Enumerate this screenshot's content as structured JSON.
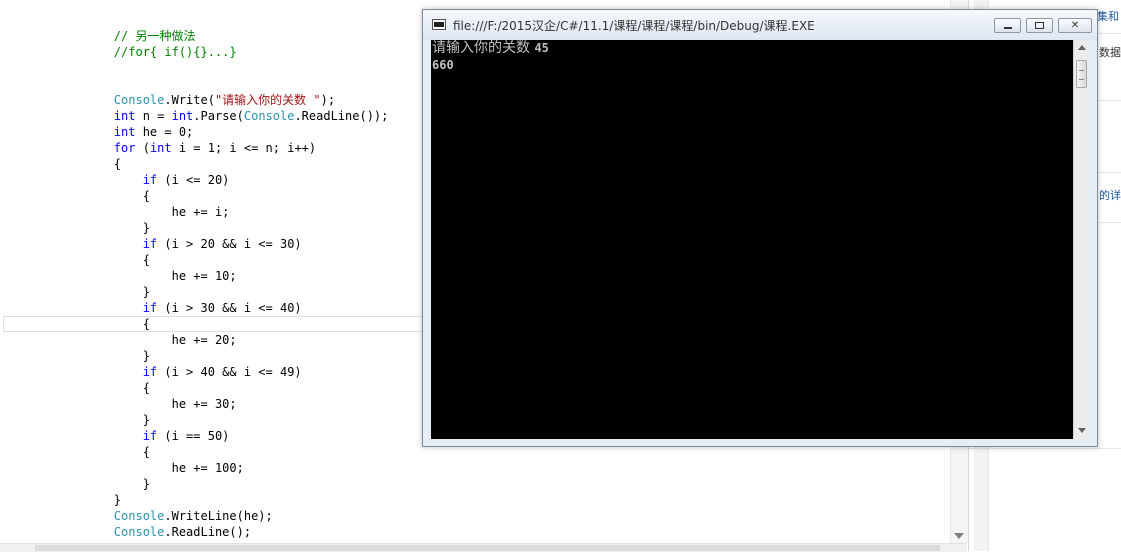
{
  "editor": {
    "lines": [
      {
        "indent": "        ",
        "segments": [
          {
            "t": "// 另一种做法",
            "c": "cm"
          }
        ]
      },
      {
        "indent": "        ",
        "segments": [
          {
            "t": "//for{ if(){}...}",
            "c": "cm"
          }
        ]
      },
      {
        "indent": "",
        "segments": []
      },
      {
        "indent": "",
        "segments": []
      },
      {
        "indent": "        ",
        "segments": [
          {
            "t": "Console",
            "c": "ty"
          },
          {
            "t": ".Write(",
            "c": ""
          },
          {
            "t": "\"请输入你的关数 \"",
            "c": "str"
          },
          {
            "t": ");",
            "c": ""
          }
        ]
      },
      {
        "indent": "        ",
        "segments": [
          {
            "t": "int",
            "c": "kw"
          },
          {
            "t": " n = ",
            "c": ""
          },
          {
            "t": "int",
            "c": "kw"
          },
          {
            "t": ".Parse(",
            "c": ""
          },
          {
            "t": "Console",
            "c": "ty"
          },
          {
            "t": ".ReadLine());",
            "c": ""
          }
        ]
      },
      {
        "indent": "        ",
        "segments": [
          {
            "t": "int",
            "c": "kw"
          },
          {
            "t": " he = 0;",
            "c": ""
          }
        ]
      },
      {
        "indent": "        ",
        "segments": [
          {
            "t": "for",
            "c": "kw"
          },
          {
            "t": " (",
            "c": ""
          },
          {
            "t": "int",
            "c": "kw"
          },
          {
            "t": " i = 1; i <= n; i++)",
            "c": ""
          }
        ]
      },
      {
        "indent": "        ",
        "segments": [
          {
            "t": "{",
            "c": ""
          }
        ]
      },
      {
        "indent": "            ",
        "segments": [
          {
            "t": "if",
            "c": "kw"
          },
          {
            "t": " (i <= 20)",
            "c": ""
          }
        ]
      },
      {
        "indent": "            ",
        "segments": [
          {
            "t": "{",
            "c": ""
          }
        ]
      },
      {
        "indent": "                ",
        "segments": [
          {
            "t": "he += i;",
            "c": ""
          }
        ]
      },
      {
        "indent": "            ",
        "segments": [
          {
            "t": "}",
            "c": ""
          }
        ]
      },
      {
        "indent": "            ",
        "segments": [
          {
            "t": "if",
            "c": "kw"
          },
          {
            "t": " (i > 20 && i <= 30)",
            "c": ""
          }
        ]
      },
      {
        "indent": "            ",
        "segments": [
          {
            "t": "{",
            "c": ""
          }
        ]
      },
      {
        "indent": "                ",
        "segments": [
          {
            "t": "he += 10;",
            "c": ""
          }
        ]
      },
      {
        "indent": "            ",
        "segments": [
          {
            "t": "}",
            "c": ""
          }
        ]
      },
      {
        "indent": "            ",
        "segments": [
          {
            "t": "if",
            "c": "kw"
          },
          {
            "t": " (i > 30 && i <= 40)",
            "c": ""
          }
        ]
      },
      {
        "indent": "            ",
        "segments": [
          {
            "t": "{",
            "c": ""
          }
        ]
      },
      {
        "indent": "                ",
        "segments": [
          {
            "t": "he += 20;",
            "c": ""
          }
        ]
      },
      {
        "indent": "            ",
        "segments": [
          {
            "t": "}",
            "c": ""
          }
        ]
      },
      {
        "indent": "            ",
        "segments": [
          {
            "t": "if",
            "c": "kw"
          },
          {
            "t": " (i > 40 && i <= 49)",
            "c": ""
          }
        ]
      },
      {
        "indent": "            ",
        "segments": [
          {
            "t": "{",
            "c": ""
          }
        ]
      },
      {
        "indent": "                ",
        "segments": [
          {
            "t": "he += 30;",
            "c": ""
          }
        ]
      },
      {
        "indent": "            ",
        "segments": [
          {
            "t": "}",
            "c": ""
          }
        ]
      },
      {
        "indent": "            ",
        "segments": [
          {
            "t": "if",
            "c": "kw"
          },
          {
            "t": " (i == 50)",
            "c": ""
          }
        ]
      },
      {
        "indent": "            ",
        "segments": [
          {
            "t": "{",
            "c": ""
          }
        ]
      },
      {
        "indent": "                ",
        "segments": [
          {
            "t": "he += 100;",
            "c": ""
          }
        ]
      },
      {
        "indent": "            ",
        "segments": [
          {
            "t": "}",
            "c": ""
          }
        ]
      },
      {
        "indent": "        ",
        "segments": [
          {
            "t": "}",
            "c": ""
          }
        ]
      },
      {
        "indent": "        ",
        "segments": [
          {
            "t": "Console",
            "c": "ty"
          },
          {
            "t": ".WriteLine(he);",
            "c": ""
          }
        ]
      },
      {
        "indent": "        ",
        "segments": [
          {
            "t": "Console",
            "c": "ty"
          },
          {
            "t": ".ReadLine();",
            "c": ""
          }
        ]
      }
    ]
  },
  "console_window": {
    "title": "file:///F:/2015汉企/C#/11.1/课程/课程/课程/bin/Debug/课程.EXE",
    "prompt_text": "请输入你的关数 ",
    "input_value": "45",
    "output_value": "660",
    "buttons": {
      "minimize": "",
      "maximize": "",
      "close": "✕"
    },
    "scrollbar_icons": {
      "up": "triangle-up-icon",
      "down": "triangle-down-icon"
    }
  },
  "side_panel": {
    "items": [
      "集和",
      "数据",
      "",
      "的详"
    ]
  },
  "colors": {
    "keyword": "#0000ff",
    "type": "#2b91af",
    "string": "#a31515",
    "comment": "#008000",
    "console_bg": "#000000",
    "console_text": "#c0c0c0"
  }
}
